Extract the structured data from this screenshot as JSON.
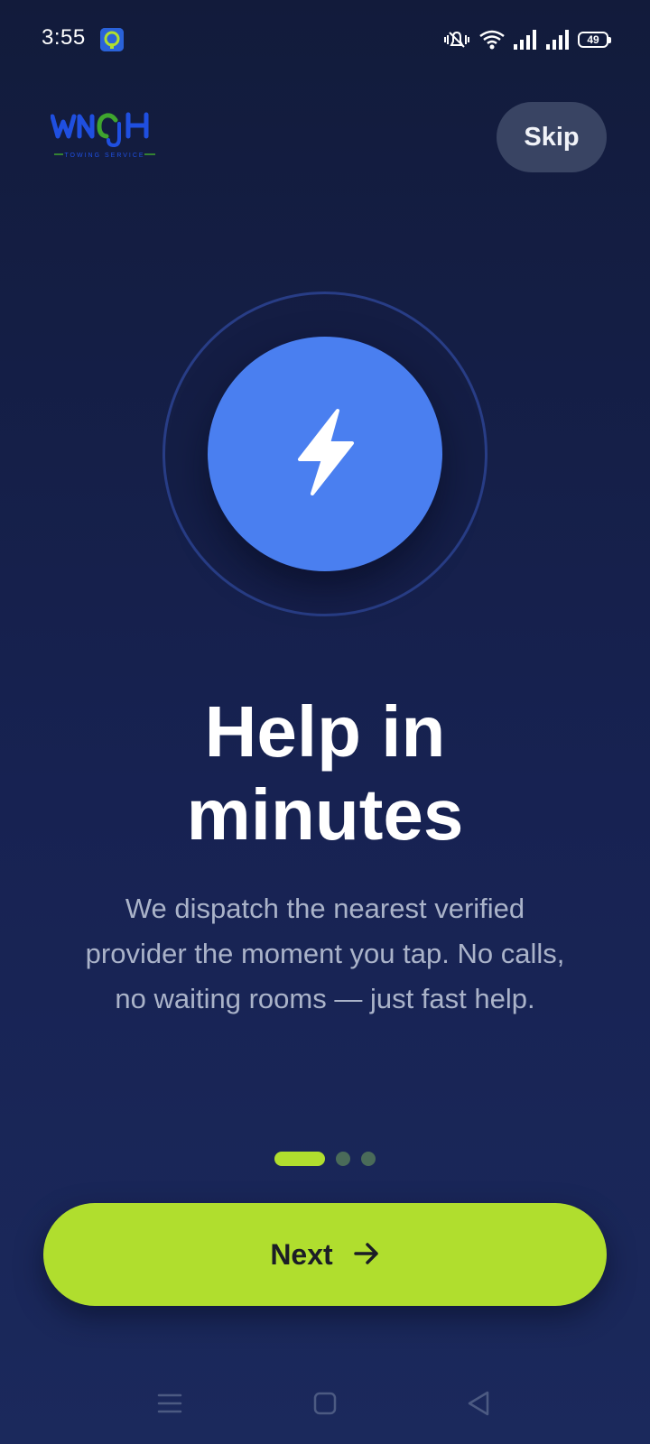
{
  "status_bar": {
    "time": "3:55",
    "battery": "49",
    "icons": [
      "app-icon",
      "mute-icon",
      "wifi-icon",
      "signal-icon",
      "signal-icon",
      "battery-icon"
    ]
  },
  "header": {
    "logo_text": "WNCH",
    "logo_tagline": "TOWING SERVICE",
    "skip_label": "Skip"
  },
  "hero": {
    "icon": "lightning-bolt-icon",
    "title_line1": "Help in",
    "title_line2": "minutes",
    "description": "We dispatch the nearest verified provider the moment you tap. No calls, no waiting rooms — just fast help."
  },
  "pager": {
    "total": 3,
    "active_index": 0
  },
  "next_button": {
    "label": "Next",
    "icon": "arrow-right-icon"
  },
  "nav_bar": {
    "icons": [
      "menu-icon",
      "home-square-icon",
      "back-triangle-icon"
    ]
  },
  "colors": {
    "background_top": "#121b3b",
    "background_bottom": "#1b295c",
    "accent": "#b0de2e",
    "hero_blue": "#4a7ff0",
    "skip_bg": "#394463"
  }
}
